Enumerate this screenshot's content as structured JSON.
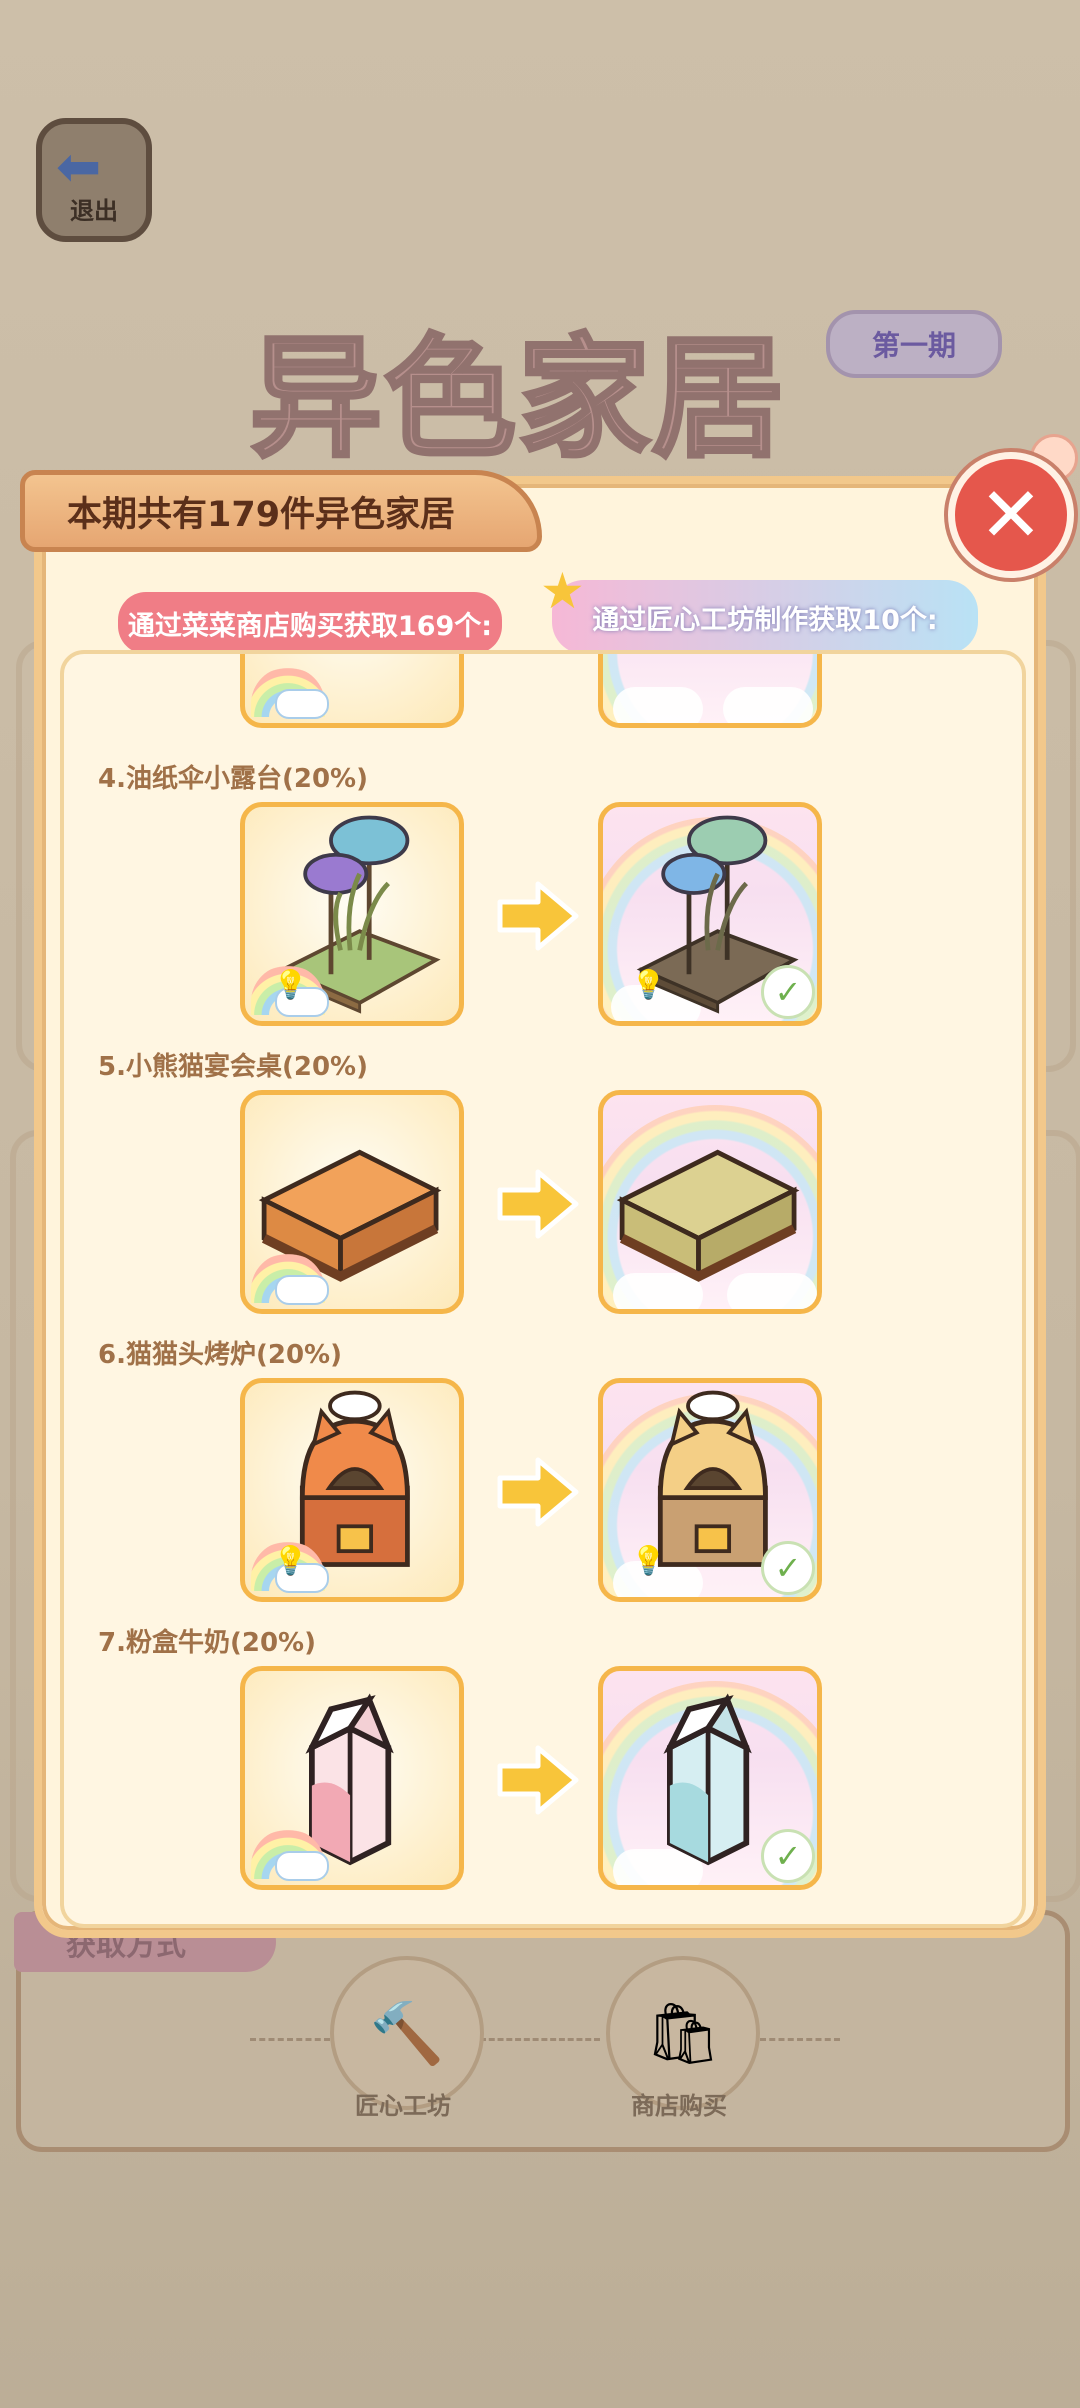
{
  "scene": {
    "exit_label": "退出",
    "banner_title": "异色家居",
    "issue_badge": "第一期",
    "acquire_tag": "获取方式",
    "acquire_options": [
      "匠心工坊",
      "商店购买"
    ]
  },
  "modal": {
    "title": "本期共有179件异色家居",
    "source_shop": "通过菜菜商店购买获取169个:",
    "source_workshop": "通过匠心工坊制作获取10个:",
    "items": [
      {
        "title": "4.油纸伞小露台(20%)",
        "owned": true,
        "icon": "umbrella-terrace"
      },
      {
        "title": "5.小熊猫宴会桌(20%)",
        "owned": false,
        "icon": "banquet-table"
      },
      {
        "title": "6.猫猫头烤炉(20%)",
        "owned": true,
        "icon": "cat-oven"
      },
      {
        "title": "7.粉盒牛奶(20%)",
        "owned": true,
        "icon": "milk-carton"
      }
    ]
  },
  "colors": {
    "card_border": "#f5b64a",
    "arrow": "#f8c53a",
    "close_red": "#e5574c",
    "item_title": "#a07148"
  }
}
